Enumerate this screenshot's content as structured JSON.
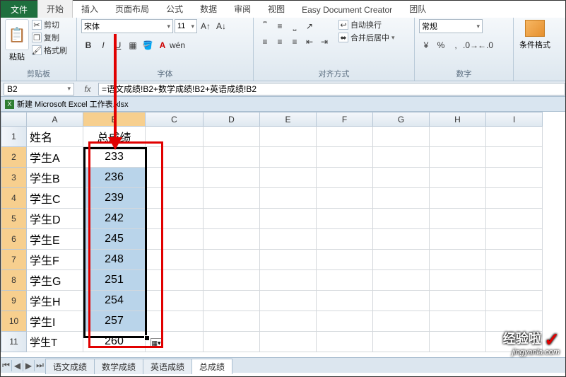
{
  "tabs": {
    "file": "文件",
    "items": [
      "开始",
      "插入",
      "页面布局",
      "公式",
      "数据",
      "审阅",
      "视图",
      "Easy Document Creator",
      "团队"
    ],
    "active_index": 0
  },
  "clipboard": {
    "label": "剪贴板",
    "paste": "粘贴",
    "cut": "剪切",
    "copy": "复制",
    "format_painter": "格式刷"
  },
  "font_group": {
    "label": "字体",
    "font_name": "宋体",
    "font_size": "11"
  },
  "align_group": {
    "label": "对齐方式",
    "wrap": "自动换行",
    "merge": "合并后居中"
  },
  "number_group": {
    "label": "数字",
    "format": "常规"
  },
  "style_group": {
    "cond_format": "条件格式"
  },
  "name_box": "B2",
  "formula": "=语文成绩!B2+数学成绩!B2+英语成绩!B2",
  "doc_title": "新建 Microsoft Excel 工作表.xlsx",
  "columns": [
    "A",
    "B",
    "C",
    "D",
    "E",
    "F",
    "G",
    "H",
    "I"
  ],
  "rows": [
    {
      "n": "1",
      "A": "姓名",
      "B": "总成绩"
    },
    {
      "n": "2",
      "A": "学生A",
      "B": "233"
    },
    {
      "n": "3",
      "A": "学生B",
      "B": "236"
    },
    {
      "n": "4",
      "A": "学生C",
      "B": "239"
    },
    {
      "n": "5",
      "A": "学生D",
      "B": "242"
    },
    {
      "n": "6",
      "A": "学生E",
      "B": "245"
    },
    {
      "n": "7",
      "A": "学生F",
      "B": "248"
    },
    {
      "n": "8",
      "A": "学生G",
      "B": "251"
    },
    {
      "n": "9",
      "A": "学生H",
      "B": "254"
    },
    {
      "n": "10",
      "A": "学生I",
      "B": "257"
    },
    {
      "n": "11",
      "A": "学生T",
      "B": "260"
    }
  ],
  "sheet_tabs": [
    "语文成绩",
    "数学成绩",
    "英语成绩",
    "总成绩"
  ],
  "active_sheet_index": 3,
  "watermark": {
    "brand": "经验啦",
    "url": "jingyanla.com"
  }
}
